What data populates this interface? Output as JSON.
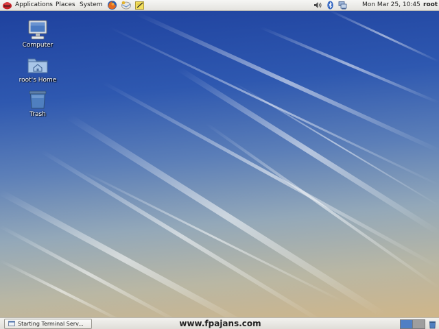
{
  "top_panel": {
    "menus": [
      "Applications",
      "Places",
      "System"
    ],
    "launchers": [
      "firefox-icon",
      "email-icon",
      "notes-icon"
    ],
    "tray": [
      "volume-icon",
      "bluetooth-icon",
      "network-icon"
    ],
    "clock": "Mon Mar 25, 10:45",
    "user": "root"
  },
  "desktop": {
    "icons": [
      {
        "label": "Computer",
        "icon": "computer-icon"
      },
      {
        "label": "root's Home",
        "icon": "home-folder-icon"
      },
      {
        "label": "Trash",
        "icon": "trash-icon"
      }
    ]
  },
  "bottom_panel": {
    "task_button": "Starting Terminal Serv...",
    "watermark": "www.fpajans.com",
    "workspace_colors": [
      "#4f7fc4",
      "#9e9e9e"
    ]
  },
  "colors": {
    "panel": "#e8e7e3",
    "accent": "#3d68b5"
  }
}
